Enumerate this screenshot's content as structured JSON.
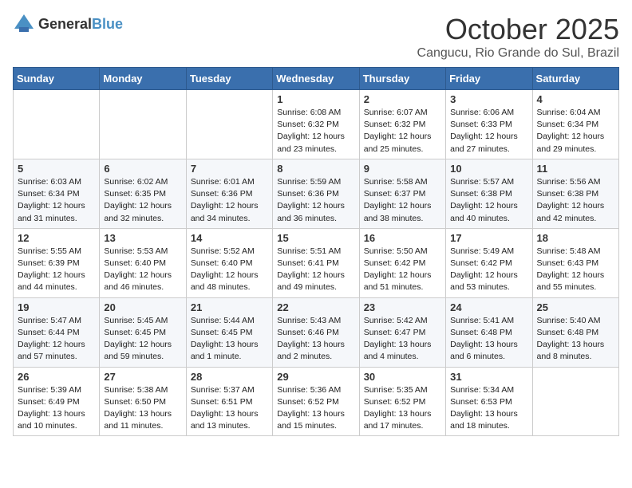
{
  "logo": {
    "general": "General",
    "blue": "Blue"
  },
  "header": {
    "month": "October 2025",
    "location": "Cangucu, Rio Grande do Sul, Brazil"
  },
  "days_of_week": [
    "Sunday",
    "Monday",
    "Tuesday",
    "Wednesday",
    "Thursday",
    "Friday",
    "Saturday"
  ],
  "weeks": [
    [
      {
        "day": "",
        "info": ""
      },
      {
        "day": "",
        "info": ""
      },
      {
        "day": "",
        "info": ""
      },
      {
        "day": "1",
        "info": "Sunrise: 6:08 AM\nSunset: 6:32 PM\nDaylight: 12 hours\nand 23 minutes."
      },
      {
        "day": "2",
        "info": "Sunrise: 6:07 AM\nSunset: 6:32 PM\nDaylight: 12 hours\nand 25 minutes."
      },
      {
        "day": "3",
        "info": "Sunrise: 6:06 AM\nSunset: 6:33 PM\nDaylight: 12 hours\nand 27 minutes."
      },
      {
        "day": "4",
        "info": "Sunrise: 6:04 AM\nSunset: 6:34 PM\nDaylight: 12 hours\nand 29 minutes."
      }
    ],
    [
      {
        "day": "5",
        "info": "Sunrise: 6:03 AM\nSunset: 6:34 PM\nDaylight: 12 hours\nand 31 minutes."
      },
      {
        "day": "6",
        "info": "Sunrise: 6:02 AM\nSunset: 6:35 PM\nDaylight: 12 hours\nand 32 minutes."
      },
      {
        "day": "7",
        "info": "Sunrise: 6:01 AM\nSunset: 6:36 PM\nDaylight: 12 hours\nand 34 minutes."
      },
      {
        "day": "8",
        "info": "Sunrise: 5:59 AM\nSunset: 6:36 PM\nDaylight: 12 hours\nand 36 minutes."
      },
      {
        "day": "9",
        "info": "Sunrise: 5:58 AM\nSunset: 6:37 PM\nDaylight: 12 hours\nand 38 minutes."
      },
      {
        "day": "10",
        "info": "Sunrise: 5:57 AM\nSunset: 6:38 PM\nDaylight: 12 hours\nand 40 minutes."
      },
      {
        "day": "11",
        "info": "Sunrise: 5:56 AM\nSunset: 6:38 PM\nDaylight: 12 hours\nand 42 minutes."
      }
    ],
    [
      {
        "day": "12",
        "info": "Sunrise: 5:55 AM\nSunset: 6:39 PM\nDaylight: 12 hours\nand 44 minutes."
      },
      {
        "day": "13",
        "info": "Sunrise: 5:53 AM\nSunset: 6:40 PM\nDaylight: 12 hours\nand 46 minutes."
      },
      {
        "day": "14",
        "info": "Sunrise: 5:52 AM\nSunset: 6:40 PM\nDaylight: 12 hours\nand 48 minutes."
      },
      {
        "day": "15",
        "info": "Sunrise: 5:51 AM\nSunset: 6:41 PM\nDaylight: 12 hours\nand 49 minutes."
      },
      {
        "day": "16",
        "info": "Sunrise: 5:50 AM\nSunset: 6:42 PM\nDaylight: 12 hours\nand 51 minutes."
      },
      {
        "day": "17",
        "info": "Sunrise: 5:49 AM\nSunset: 6:42 PM\nDaylight: 12 hours\nand 53 minutes."
      },
      {
        "day": "18",
        "info": "Sunrise: 5:48 AM\nSunset: 6:43 PM\nDaylight: 12 hours\nand 55 minutes."
      }
    ],
    [
      {
        "day": "19",
        "info": "Sunrise: 5:47 AM\nSunset: 6:44 PM\nDaylight: 12 hours\nand 57 minutes."
      },
      {
        "day": "20",
        "info": "Sunrise: 5:45 AM\nSunset: 6:45 PM\nDaylight: 12 hours\nand 59 minutes."
      },
      {
        "day": "21",
        "info": "Sunrise: 5:44 AM\nSunset: 6:45 PM\nDaylight: 13 hours\nand 1 minute."
      },
      {
        "day": "22",
        "info": "Sunrise: 5:43 AM\nSunset: 6:46 PM\nDaylight: 13 hours\nand 2 minutes."
      },
      {
        "day": "23",
        "info": "Sunrise: 5:42 AM\nSunset: 6:47 PM\nDaylight: 13 hours\nand 4 minutes."
      },
      {
        "day": "24",
        "info": "Sunrise: 5:41 AM\nSunset: 6:48 PM\nDaylight: 13 hours\nand 6 minutes."
      },
      {
        "day": "25",
        "info": "Sunrise: 5:40 AM\nSunset: 6:48 PM\nDaylight: 13 hours\nand 8 minutes."
      }
    ],
    [
      {
        "day": "26",
        "info": "Sunrise: 5:39 AM\nSunset: 6:49 PM\nDaylight: 13 hours\nand 10 minutes."
      },
      {
        "day": "27",
        "info": "Sunrise: 5:38 AM\nSunset: 6:50 PM\nDaylight: 13 hours\nand 11 minutes."
      },
      {
        "day": "28",
        "info": "Sunrise: 5:37 AM\nSunset: 6:51 PM\nDaylight: 13 hours\nand 13 minutes."
      },
      {
        "day": "29",
        "info": "Sunrise: 5:36 AM\nSunset: 6:52 PM\nDaylight: 13 hours\nand 15 minutes."
      },
      {
        "day": "30",
        "info": "Sunrise: 5:35 AM\nSunset: 6:52 PM\nDaylight: 13 hours\nand 17 minutes."
      },
      {
        "day": "31",
        "info": "Sunrise: 5:34 AM\nSunset: 6:53 PM\nDaylight: 13 hours\nand 18 minutes."
      },
      {
        "day": "",
        "info": ""
      }
    ]
  ]
}
